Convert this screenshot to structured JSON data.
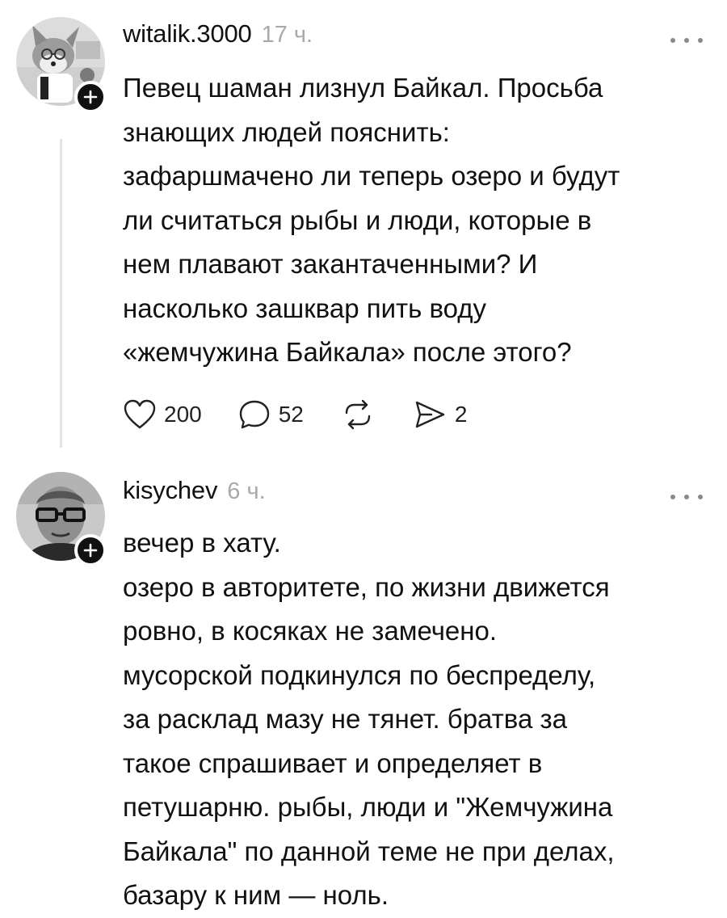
{
  "posts": [
    {
      "username": "witalik.3000",
      "time": "17 ч.",
      "lines": [
        "Певец шаман лизнул Байкал. Просьба",
        "знающих людей пояснить:",
        "зафаршмачено ли теперь озеро и будут",
        "ли считаться рыбы и люди, которые в",
        "нем плавают закантаченными? И",
        "насколько зашквар пить воду",
        "«жемчужина Байкала» после этого?"
      ],
      "actions": {
        "likes": "200",
        "comments": "52",
        "shares": "2"
      }
    },
    {
      "username": "kisychev",
      "time": "6 ч.",
      "lines": [
        "вечер в хату.",
        "озеро в авторитете, по жизни движется",
        "ровно, в косяках не замечено.",
        "мусорской подкинулся по беспределу,",
        "за расклад мазу не тянет. братва за",
        "такое спрашивает и определяет в",
        "петушарню. рыбы, люди и \"Жемчужина",
        "Байкала\" по данной теме не при делах,",
        "базару к ним — ноль."
      ]
    }
  ],
  "icons": {
    "more": "more-horizontal-icon",
    "follow": "plus-icon",
    "like": "heart-icon",
    "comment": "comment-bubble-icon",
    "repost": "repost-icon",
    "share": "send-icon"
  },
  "colors": {
    "text": "#111111",
    "muted": "#a9a9a9",
    "thread_line": "#e3e3e3",
    "badge": "#111111"
  }
}
